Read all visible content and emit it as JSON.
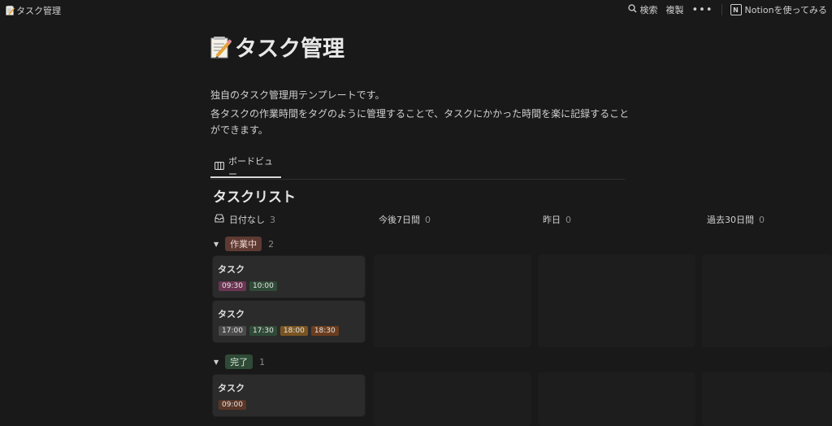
{
  "breadcrumb": {
    "title": "タスク管理"
  },
  "topbar": {
    "search": "検索",
    "duplicate": "複製",
    "more": "•••",
    "notion": "Notionを使ってみる"
  },
  "page": {
    "title": "タスク管理",
    "description": [
      "独自のタスク管理用テンプレートです。",
      "各タスクの作業時間をタグのように管理することで、タスクにかかった時間を楽に記録することができます。"
    ]
  },
  "view_tab": {
    "label": "ボードビュー"
  },
  "database": {
    "title": "タスクリスト"
  },
  "columns": [
    {
      "label": "日付なし",
      "count": "3"
    },
    {
      "label": "今後7日間",
      "count": "0"
    },
    {
      "label": "昨日",
      "count": "0"
    },
    {
      "label": "過去30日間",
      "count": "0"
    }
  ],
  "groups": [
    {
      "label": "作業中",
      "count": "2",
      "color": "#5e3a33",
      "text_color": "#f0d6cf"
    },
    {
      "label": "完了",
      "count": "1",
      "color": "#2f4a36",
      "text_color": "#d6ecd9"
    }
  ],
  "cards": [
    {
      "title": "タスク",
      "tags": [
        {
          "text": "09:30",
          "color": "#6a3552"
        },
        {
          "text": "10:00",
          "color": "#2f4a36"
        }
      ]
    },
    {
      "title": "タスク",
      "tags": [
        {
          "text": "17:00",
          "color": "#4a4a4a"
        },
        {
          "text": "17:30",
          "color": "#2f4a36"
        },
        {
          "text": "18:00",
          "color": "#7a5522"
        },
        {
          "text": "18:30",
          "color": "#6b3d1e"
        }
      ]
    },
    {
      "title": "タスク",
      "tags": [
        {
          "text": "09:00",
          "color": "#5a3626"
        }
      ]
    }
  ]
}
